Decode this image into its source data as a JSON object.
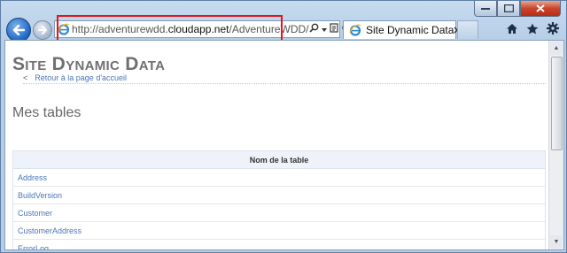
{
  "browser": {
    "address_bar": {
      "url_prefix": "http://adventurewdd.",
      "url_host": "cloudapp.net",
      "url_path": "/AdventureWDD/"
    },
    "tab": {
      "title": "Site Dynamic Data"
    },
    "highlight_color": "#e0161c",
    "icons": [
      "back-arrow-icon",
      "forward-arrow-icon",
      "ie-logo-icon",
      "search-icon",
      "compat-view-icon",
      "refresh-icon",
      "close-icon",
      "home-icon",
      "favorites-star-icon",
      "settings-gear-icon"
    ]
  },
  "page": {
    "site_title": "Site Dynamic Data",
    "back_link": "Retour à la page d'accueil",
    "section_title": "Mes tables",
    "table": {
      "header": "Nom de la table",
      "rows": [
        "Address",
        "BuildVersion",
        "Customer",
        "CustomerAddress",
        "ErrorLog"
      ]
    }
  }
}
